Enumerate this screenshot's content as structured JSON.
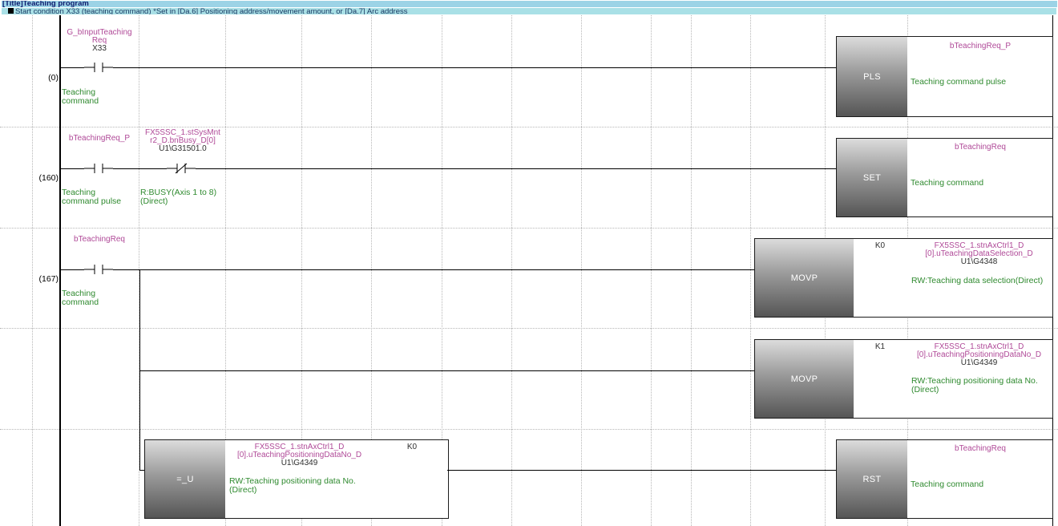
{
  "title": "[Title]Teaching program",
  "comment": "Start condition X33 (teaching command) *Set in [Da.6] Positioning address/movement amount, or [Da.7] Arc address",
  "rungs": [
    {
      "step": "(0)",
      "contact1": {
        "label_line1": "G_bInputTeaching",
        "label_line2": "Req",
        "address": "X33",
        "comment_line1": "Teaching",
        "comment_line2": "command",
        "type": "normally-open"
      },
      "instruction": {
        "name": "PLS",
        "device": "bTeachingReq_P",
        "comment": "Teaching command pulse"
      }
    },
    {
      "step": "(160)",
      "contact1": {
        "label_line1": "bTeachingReq_P",
        "comment_line1": "Teaching",
        "comment_line2": "command pulse",
        "type": "normally-open"
      },
      "contact2": {
        "label_line1": "FX5SSC_1.stSysMnt",
        "label_line2": "r2_D.bnBusy_D[0]",
        "address": "U1\\G31501.0",
        "comment_line1": "R:BUSY(Axis 1 to 8)",
        "comment_line2": "(Direct)",
        "type": "normally-closed"
      },
      "instruction": {
        "name": "SET",
        "device": "bTeachingReq",
        "comment": "Teaching command"
      }
    },
    {
      "step": "(167)",
      "contact1": {
        "label_line1": "bTeachingReq",
        "comment_line1": "Teaching",
        "comment_line2": "command",
        "type": "normally-open"
      },
      "instruction": {
        "name": "MOVP",
        "source": "K0",
        "dest_line1": "FX5SSC_1.stnAxCtrl1_D",
        "dest_line2": "[0].uTeachingDataSelection_D",
        "dest_address": "U1\\G4348",
        "comment": "RW:Teaching data selection(Direct)"
      }
    },
    {
      "instruction": {
        "name": "MOVP",
        "source": "K1",
        "dest_line1": "FX5SSC_1.stnAxCtrl1_D",
        "dest_line2": "[0].uTeachingPositioningDataNo_D",
        "dest_address": "U1\\G4349",
        "comment_line1": "RW:Teaching positioning data No.",
        "comment_line2": "(Direct)"
      }
    },
    {
      "compare": {
        "name": "=_U",
        "operand1_line1": "FX5SSC_1.stnAxCtrl1_D",
        "operand1_line2": "[0].uTeachingPositioningDataNo_D",
        "operand1_address": "U1\\G4349",
        "operand1_comment_line1": "RW:Teaching positioning data No.",
        "operand1_comment_line2": "(Direct)",
        "operand2": "K0"
      },
      "instruction": {
        "name": "RST",
        "device": "bTeachingReq",
        "comment": "Teaching command"
      }
    }
  ]
}
